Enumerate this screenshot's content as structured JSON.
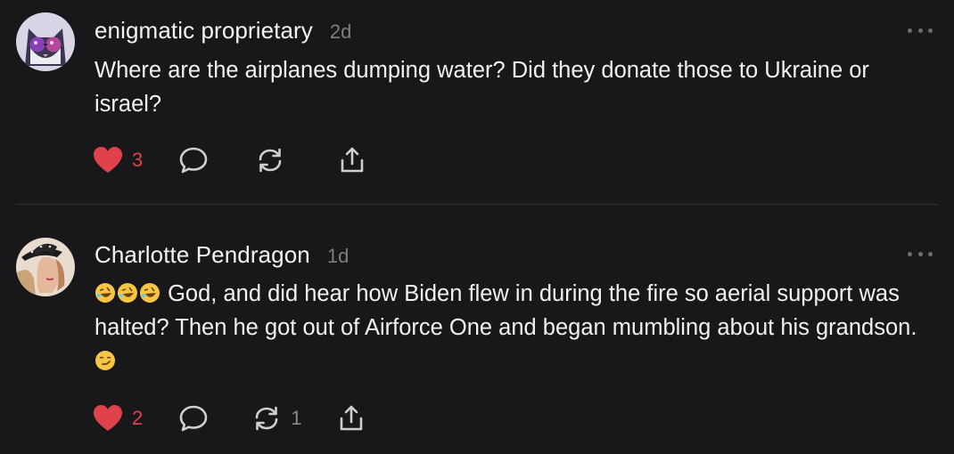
{
  "comments": [
    {
      "author": "enigmatic proprietary",
      "age": "2d",
      "text": "Where are the airplanes dumping water? Did they donate those to Ukraine or israel?",
      "likes": "3",
      "reposts": ""
    },
    {
      "author": "Charlotte Pendragon",
      "age": "1d",
      "text": "God, and did hear how Biden flew in during the fire so aerial support was halted? Then he got out of Airforce One and began mumbling about his grandson.",
      "likes": "2",
      "reposts": "1"
    }
  ],
  "icons": {
    "like": "heart-icon",
    "reply": "comment-icon",
    "repost": "repost-icon",
    "share": "share-icon",
    "more": "more-icon",
    "laugh": "rolling-on-floor-laughing-emoji",
    "smirk": "smirking-face-emoji"
  },
  "colors": {
    "background": "#18181a",
    "like": "#e0424c",
    "muted": "#7d7d82"
  }
}
